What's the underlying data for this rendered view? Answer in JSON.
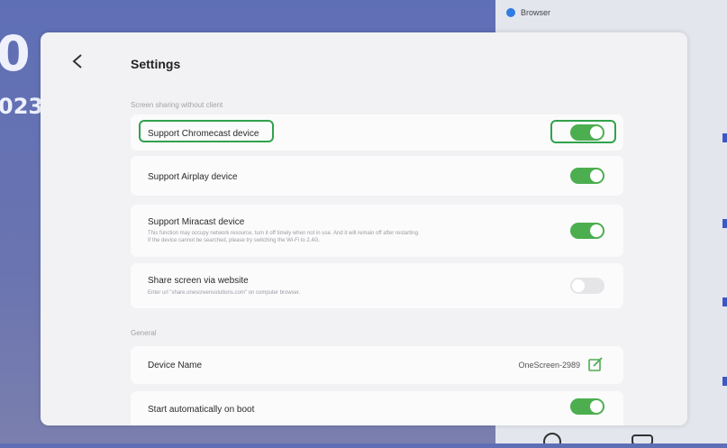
{
  "background": {
    "clock_partial": "0",
    "date_partial": "023",
    "accent_color": "#3c58c4"
  },
  "right_panel": {
    "browser_label": "Browser"
  },
  "settings": {
    "title": "Settings",
    "sections": [
      {
        "label": "Screen sharing without client",
        "items": [
          {
            "label": "Support Chromecast device",
            "toggle": "on",
            "highlighted": true
          },
          {
            "label": "Support Airplay device",
            "toggle": "on"
          },
          {
            "label": "Support Miracast device",
            "description_line1": "This function may occupy network resource, turn it off timely when not in use. And it will remain off after restarting.",
            "description_line2": "If the device cannot be searched, please try switching the Wi-Fi to 2.4G.",
            "toggle": "on"
          },
          {
            "label": "Share screen via website",
            "description_line1": "Enter url \"share.onescreensolutions.com\" on computer browser.",
            "toggle": "off"
          }
        ]
      },
      {
        "label": "General",
        "items": [
          {
            "label": "Device Name",
            "value": "OneScreen-2989",
            "icon": "edit-icon"
          },
          {
            "label": "Start automatically on boot",
            "toggle": "on"
          }
        ]
      }
    ],
    "colors": {
      "toggle_on": "#4cae4f",
      "highlight": "#31a24c"
    }
  }
}
